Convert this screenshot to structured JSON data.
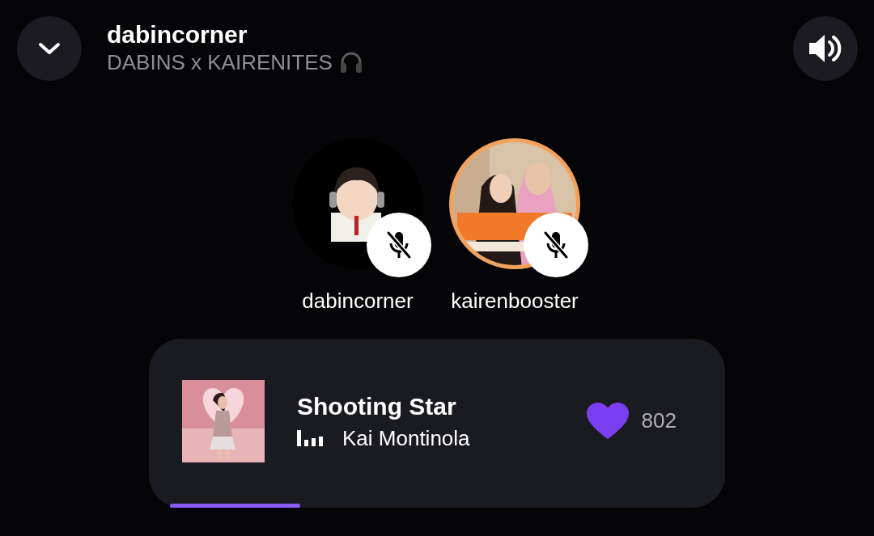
{
  "header": {
    "title": "dabincorner",
    "subtitle": "DABINS x KAIRENITES"
  },
  "speakers": [
    {
      "name": "dabincorner",
      "muted": true
    },
    {
      "name": "kairenbooster",
      "muted": true
    }
  ],
  "now_playing": {
    "title": "Shooting Star",
    "artist": "Kai Montinola",
    "liked": true,
    "likes": "802"
  }
}
